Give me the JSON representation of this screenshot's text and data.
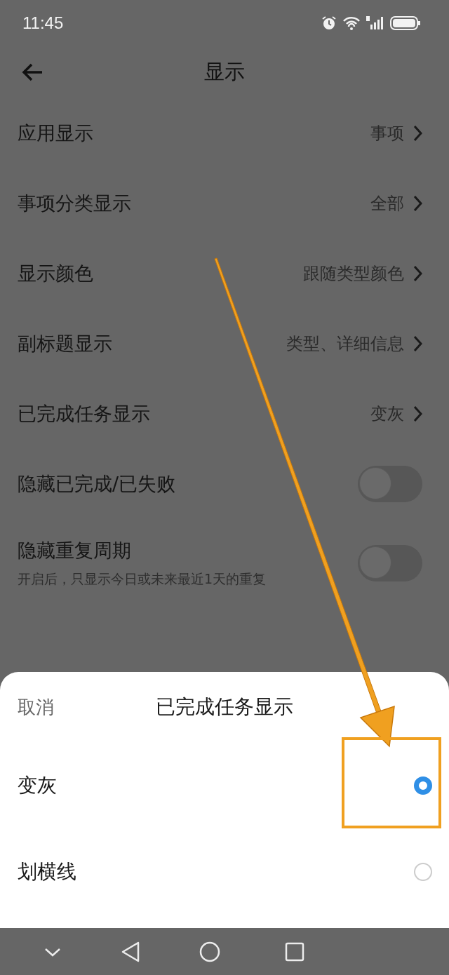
{
  "status_bar": {
    "time": "11:45"
  },
  "header": {
    "title": "显示"
  },
  "settings": [
    {
      "kind": "link",
      "label": "应用显示",
      "value": "事项"
    },
    {
      "kind": "link",
      "label": "事项分类显示",
      "value": "全部"
    },
    {
      "kind": "link",
      "label": "显示颜色",
      "value": "跟随类型颜色"
    },
    {
      "kind": "link",
      "label": "副标题显示",
      "value": "类型、详细信息"
    },
    {
      "kind": "link",
      "label": "已完成任务显示",
      "value": "变灰"
    },
    {
      "kind": "toggle",
      "label": "隐藏已完成/已失败",
      "on": false
    },
    {
      "kind": "toggle",
      "label": "隐藏重复周期",
      "description": "开启后，只显示今日或未来最近1天的重复",
      "on": false
    }
  ],
  "sheet": {
    "cancel": "取消",
    "title": "已完成任务显示",
    "options": [
      {
        "label": "变灰",
        "selected": true
      },
      {
        "label": "划横线",
        "selected": false
      }
    ]
  },
  "annotation": {
    "kind": "arrow_to_box"
  }
}
